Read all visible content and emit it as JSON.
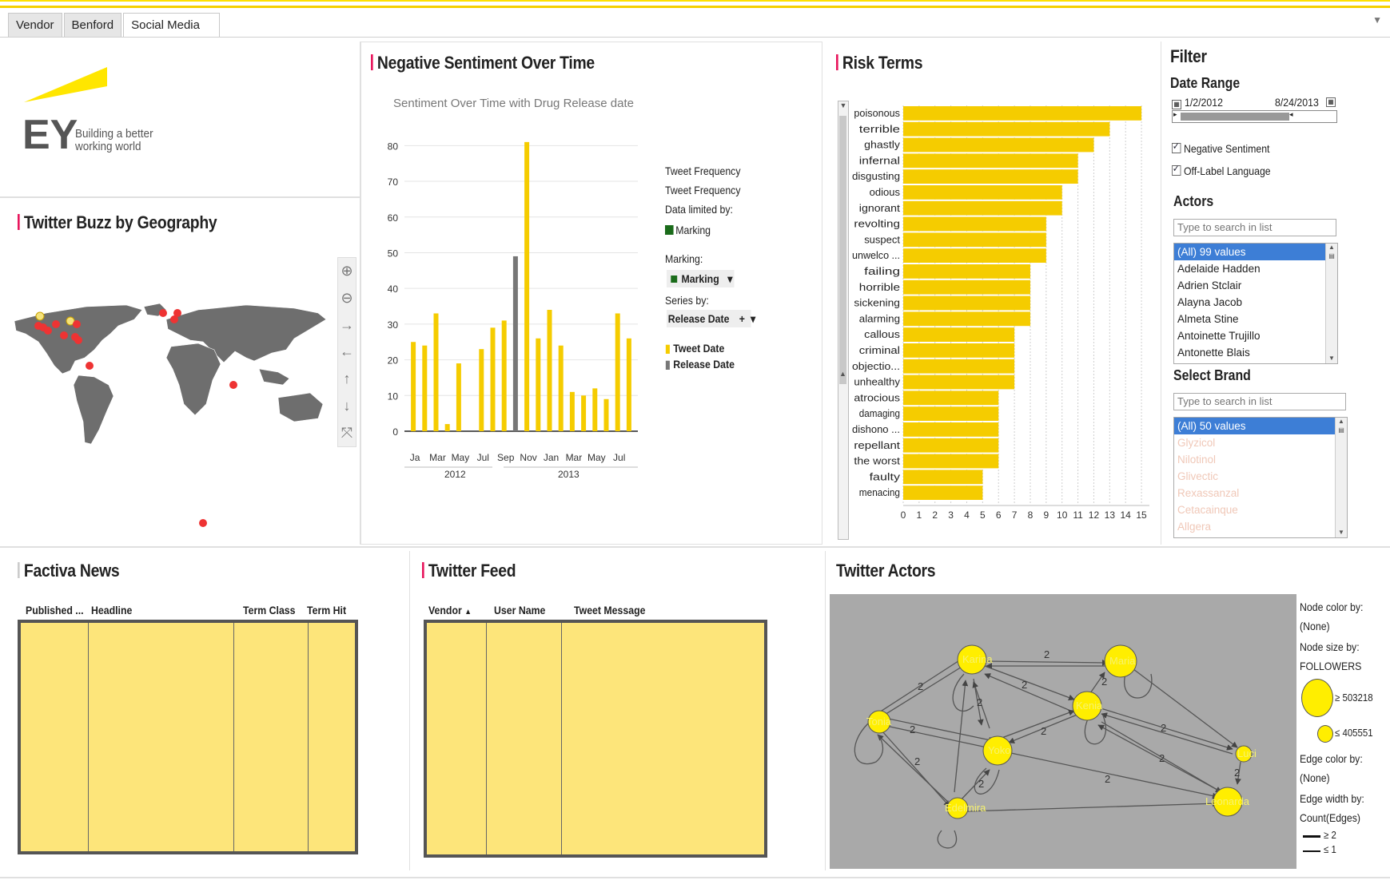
{
  "tabs": [
    "Vendor",
    "Benford",
    "Social Media"
  ],
  "logo": {
    "brand": "EY",
    "tagline_line1": "Building a better",
    "tagline_line2": "working world"
  },
  "geo": {
    "title": "Twitter Buzz by Geography",
    "controls": [
      "zoom-in",
      "zoom-out",
      "pan-right",
      "pan-left",
      "pan-up",
      "pan-down",
      "fit"
    ]
  },
  "sentiment": {
    "title": "Negative Sentiment Over Time",
    "legend": {
      "line1": "Tweet Frequency",
      "line2": "Tweet Frequency",
      "limited_by": "Data limited by:",
      "marking_item": "Marking",
      "marking_label": "Marking:",
      "marking_value": "Marking",
      "series_label": "Series by:",
      "series_value": "Release Date",
      "plus": "+",
      "key1": "Tweet Date",
      "key2": "Release Date"
    }
  },
  "risk": {
    "title": "Risk Terms"
  },
  "filter": {
    "title": "Filter",
    "date_range_label": "Date Range",
    "date_from": "1/2/2012",
    "date_to": "8/24/2013",
    "check1": "Negative Sentiment",
    "check2": "Off-Label Language",
    "actors_label": "Actors",
    "actors_placeholder": "Type to search in list",
    "actors": [
      "(All) 99 values",
      "Adelaide Hadden",
      "Adrien Stclair",
      "Alayna Jacob",
      "Almeta Stine",
      "Antoinette Trujillo",
      "Antonette Blais"
    ],
    "brand_label": "Select Brand",
    "brand_placeholder": "Type to search in list",
    "brands": [
      "(All) 50 values",
      "Glyzicol",
      "Nilotinol",
      "Glivectic",
      "Rexassanzal",
      "Cetacainque",
      "Allgera"
    ]
  },
  "factiva": {
    "title": "Factiva News",
    "columns": [
      "Published ...",
      "Headline",
      "Term Class",
      "Term Hit"
    ]
  },
  "feed": {
    "title": "Twitter Feed",
    "columns": [
      "Vendor",
      "User Name",
      "Tweet Message"
    ]
  },
  "actors_graph": {
    "title": "Twitter Actors",
    "legend": {
      "node_color_label": "Node color by:",
      "node_color_value": "(None)",
      "node_size_label": "Node size by:",
      "node_size_value": "FOLLOWERS",
      "size_big": "≥ 503218",
      "size_small": "≤ 405551",
      "edge_color_label": "Edge color by:",
      "edge_color_value": "(None)",
      "edge_width_label": "Edge width by:",
      "edge_width_value": "Count(Edges)",
      "width_big": "≥ 2",
      "width_small": "≤ 1"
    },
    "nodes": [
      "Karina",
      "Maria",
      "Tonia",
      "Kenia",
      "Yoko",
      "Luci",
      "Edelmira",
      "Leonarda"
    ],
    "edge_label": "2"
  },
  "colors": {
    "accent": "#e8175d",
    "bar": "#f5cc00",
    "release_bar": "#777777",
    "table_fill": "#fde57a",
    "graph_bg": "#a9a9a9",
    "node": "#ffee00"
  },
  "chart_data": [
    {
      "type": "bar",
      "title": "Sentiment Over Time with Drug Release date",
      "xlabel": "",
      "ylabel": "",
      "x_tick_labels": [
        "Ja",
        "Mar",
        "May",
        "Jul",
        "Sep",
        "Nov",
        "Jan",
        "Mar",
        "May",
        "Jul"
      ],
      "x_year_labels": [
        "2012",
        "2013"
      ],
      "ylim": [
        0,
        85
      ],
      "yticks": [
        0,
        10,
        20,
        30,
        40,
        50,
        60,
        70,
        80
      ],
      "series": [
        {
          "name": "Tweet Date",
          "values": [
            25,
            24,
            33,
            2,
            19,
            0,
            23,
            29,
            31,
            0,
            81,
            26,
            34,
            24,
            11,
            10,
            12,
            9,
            33,
            26
          ]
        },
        {
          "name": "Release Date",
          "values": [
            0,
            0,
            0,
            0,
            0,
            0,
            0,
            0,
            0,
            49,
            0,
            0,
            0,
            0,
            0,
            0,
            0,
            0,
            0,
            0
          ]
        }
      ]
    },
    {
      "type": "bar",
      "orientation": "horizontal",
      "title": "",
      "categories": [
        "poisonous",
        "terrible",
        "ghastly",
        "infernal",
        "disgusting",
        "odious",
        "ignorant",
        "revolting",
        "suspect",
        "unwelco ...",
        "failing",
        "horrible",
        "sickening",
        "alarming",
        "callous",
        "criminal",
        "objectio...",
        "unhealthy",
        "atrocious",
        "damaging",
        "dishono ...",
        "repellant",
        "the worst",
        "faulty",
        "menacing"
      ],
      "values": [
        15,
        13,
        12,
        11,
        11,
        10,
        10,
        9,
        9,
        9,
        8,
        8,
        8,
        8,
        7,
        7,
        7,
        7,
        6,
        6,
        6,
        6,
        6,
        5,
        5
      ],
      "xlim": [
        0,
        15.5
      ],
      "xticks": [
        0,
        1,
        2,
        3,
        4,
        5,
        6,
        7,
        8,
        9,
        10,
        11,
        12,
        13,
        14,
        15
      ]
    }
  ]
}
